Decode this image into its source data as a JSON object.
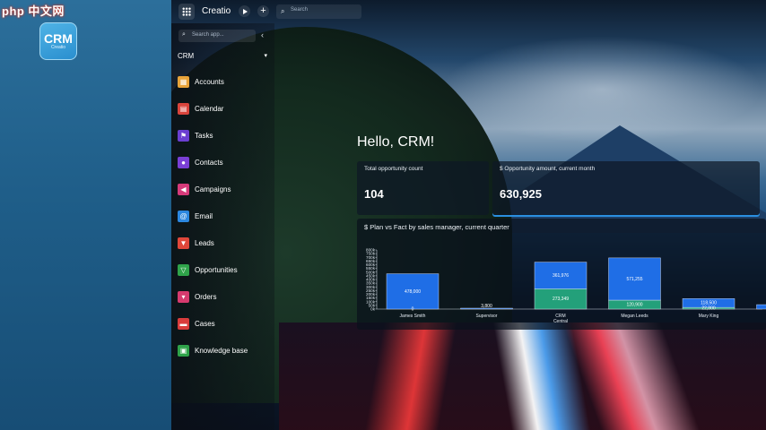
{
  "watermark": {
    "text": "php 中文网"
  },
  "app_logo": {
    "line1": "CRM",
    "line2": "Creatio"
  },
  "topbar": {
    "brand": "Creatio",
    "search_placeholder": "Search"
  },
  "sidebar": {
    "search_placeholder": "Search app...",
    "section": "CRM",
    "items": [
      {
        "label": "Accounts",
        "icon": "building-icon",
        "color": "#e8a33a"
      },
      {
        "label": "Calendar",
        "icon": "calendar-icon",
        "color": "#d9443c"
      },
      {
        "label": "Tasks",
        "icon": "flag-icon",
        "color": "#6b3fd1"
      },
      {
        "label": "Contacts",
        "icon": "person-icon",
        "color": "#7a3fd6"
      },
      {
        "label": "Campaigns",
        "icon": "megaphone-icon",
        "color": "#d63a7a"
      },
      {
        "label": "Email",
        "icon": "at-icon",
        "color": "#2c87e0"
      },
      {
        "label": "Leads",
        "icon": "funnel-icon",
        "color": "#e0473a"
      },
      {
        "label": "Opportunities",
        "icon": "filter-icon",
        "color": "#2fa34a"
      },
      {
        "label": "Orders",
        "icon": "cart-icon",
        "color": "#d63a6e"
      },
      {
        "label": "Cases",
        "icon": "chat-icon",
        "color": "#d93c3c"
      },
      {
        "label": "Knowledge base",
        "icon": "book-icon",
        "color": "#2fa34a"
      }
    ]
  },
  "dashboard": {
    "greeting": "Hello, CRM!",
    "kpis": [
      {
        "title": "Total opportunity count",
        "value": "104"
      },
      {
        "title": "$ Opportunity amount, current month",
        "value": "630,925"
      }
    ]
  },
  "chart_data": {
    "type": "bar",
    "title": "$ Plan vs Fact by sales manager, current quarter",
    "categories": [
      "James Smith",
      "Supervisor",
      "CRM Central",
      "Megan Leeds",
      "Mary King",
      ""
    ],
    "y_ticks": [
      "800k",
      "750k",
      "700k",
      "650k",
      "600k",
      "550k",
      "500k",
      "450k",
      "400k",
      "350k",
      "300k",
      "250k",
      "200k",
      "150k",
      "100k",
      "50k",
      "0k"
    ],
    "y_max": 800000,
    "series": [
      {
        "values": [
          0,
          0,
          273349,
          120900,
          22800,
          0
        ],
        "color": "#23a07a"
      },
      {
        "values": [
          478000,
          3800,
          361976,
          571255,
          118500,
          60000
        ],
        "color": "#1f6ee6"
      }
    ],
    "labels_lower": [
      "0",
      "",
      "273,349",
      "120,900",
      "22,800",
      ""
    ],
    "labels_upper": [
      "478,000",
      "3,800",
      "361,976",
      "571,255",
      "118,500",
      ""
    ],
    "legend": false
  }
}
